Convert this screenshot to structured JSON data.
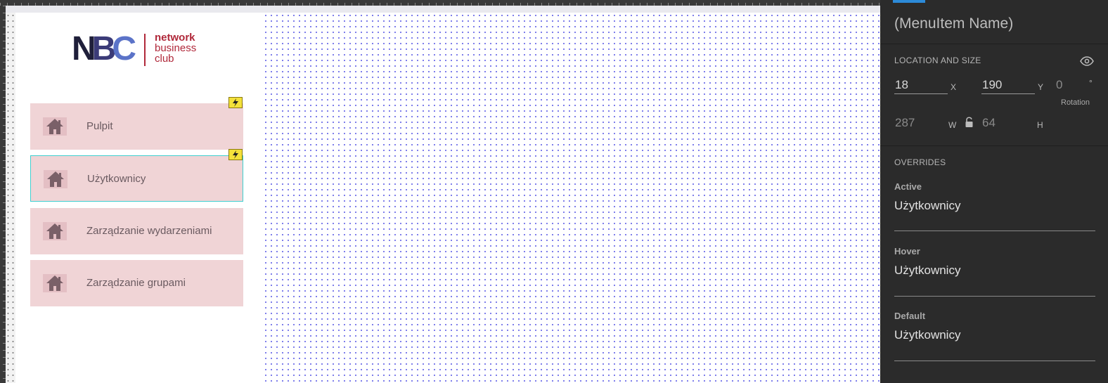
{
  "logo": {
    "letters": [
      "N",
      "B",
      "C"
    ],
    "lines": [
      "network",
      "business",
      "club"
    ]
  },
  "menu": {
    "items": [
      {
        "label": "Pulpit"
      },
      {
        "label": "Użytkownicy"
      },
      {
        "label": "Zarządzanie wydarzeniami"
      },
      {
        "label": "Zarządzanie grupami"
      }
    ]
  },
  "inspector": {
    "title": "(MenuItem Name)",
    "location_section": "LOCATION AND SIZE",
    "x_value": "18",
    "x_label": "X",
    "y_value": "190",
    "y_label": "Y",
    "rotation_value": "0",
    "rotation_unit": "°",
    "rotation_label": "Rotation",
    "w_value": "287",
    "w_label": "W",
    "h_value": "64",
    "h_label": "H",
    "overrides_section": "OVERRIDES",
    "overrides": [
      {
        "label": "Active",
        "value": "Użytkownicy"
      },
      {
        "label": "Hover",
        "value": "Użytkownicy"
      },
      {
        "label": "Default",
        "value": "Użytkownicy"
      }
    ]
  },
  "colors": {
    "accent": "#2c8ad8",
    "selection": "#3ed0d0",
    "menu_bg": "#f0d4d6",
    "brand_red": "#b0283a"
  },
  "icons": [
    "home-icon",
    "lightning-icon",
    "eye-icon",
    "lock-open-icon"
  ]
}
